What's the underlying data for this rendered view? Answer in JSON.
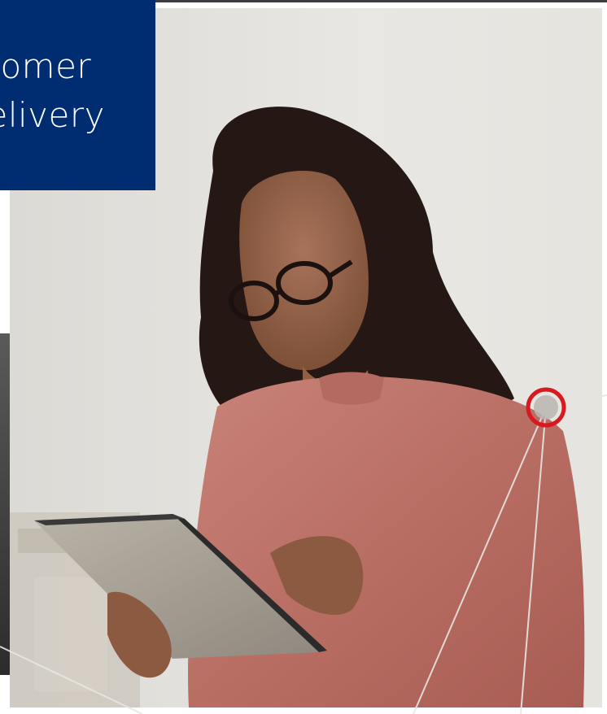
{
  "hero": {
    "headline_line1": "tomer",
    "headline_line2": "elivery"
  },
  "colors": {
    "brand_navy": "#002d72",
    "hotspot_red": "#d71920",
    "connector_line": "#e8e6e2"
  },
  "icons": {
    "hotspot": "hotspot-ring-icon"
  }
}
